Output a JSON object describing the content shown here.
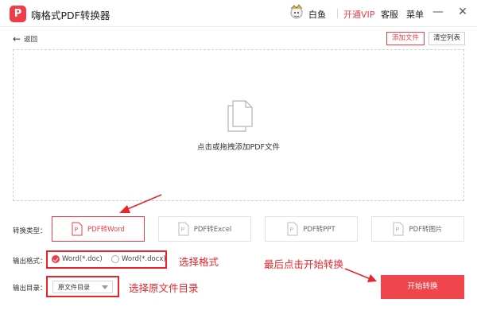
{
  "app": {
    "title": "嗨格式PDF转换器",
    "logo_letter": "P"
  },
  "header": {
    "username": "白鱼",
    "vip_label": "开通VIP",
    "service_label": "客服",
    "menu_label": "菜单"
  },
  "toolbar": {
    "back_label": "返回",
    "add_file_label": "添加文件",
    "clear_list_label": "清空列表"
  },
  "dropzone": {
    "label": "点击或拖拽添加PDF文件"
  },
  "conversion": {
    "type_label": "转换类型：",
    "types": [
      {
        "label": "PDF转Word",
        "active": true
      },
      {
        "label": "PDF转Excel",
        "active": false
      },
      {
        "label": "PDF转PPT",
        "active": false
      },
      {
        "label": "PDF转图片",
        "active": false
      }
    ]
  },
  "format": {
    "label": "输出格式：",
    "options": [
      {
        "label": "Word(*.doc)",
        "checked": true
      },
      {
        "label": "Word(*.docx)",
        "checked": false
      }
    ]
  },
  "output_dir": {
    "label": "输出目录：",
    "value": "原文件目录"
  },
  "start_button": {
    "label": "开始转换"
  },
  "annotations": {
    "select_format": "选择格式",
    "select_dir": "选择原文件目录",
    "finally_start": "最后点击开始转换"
  },
  "colors": {
    "accent": "#ef3c46",
    "annotation": "#e8242c"
  }
}
